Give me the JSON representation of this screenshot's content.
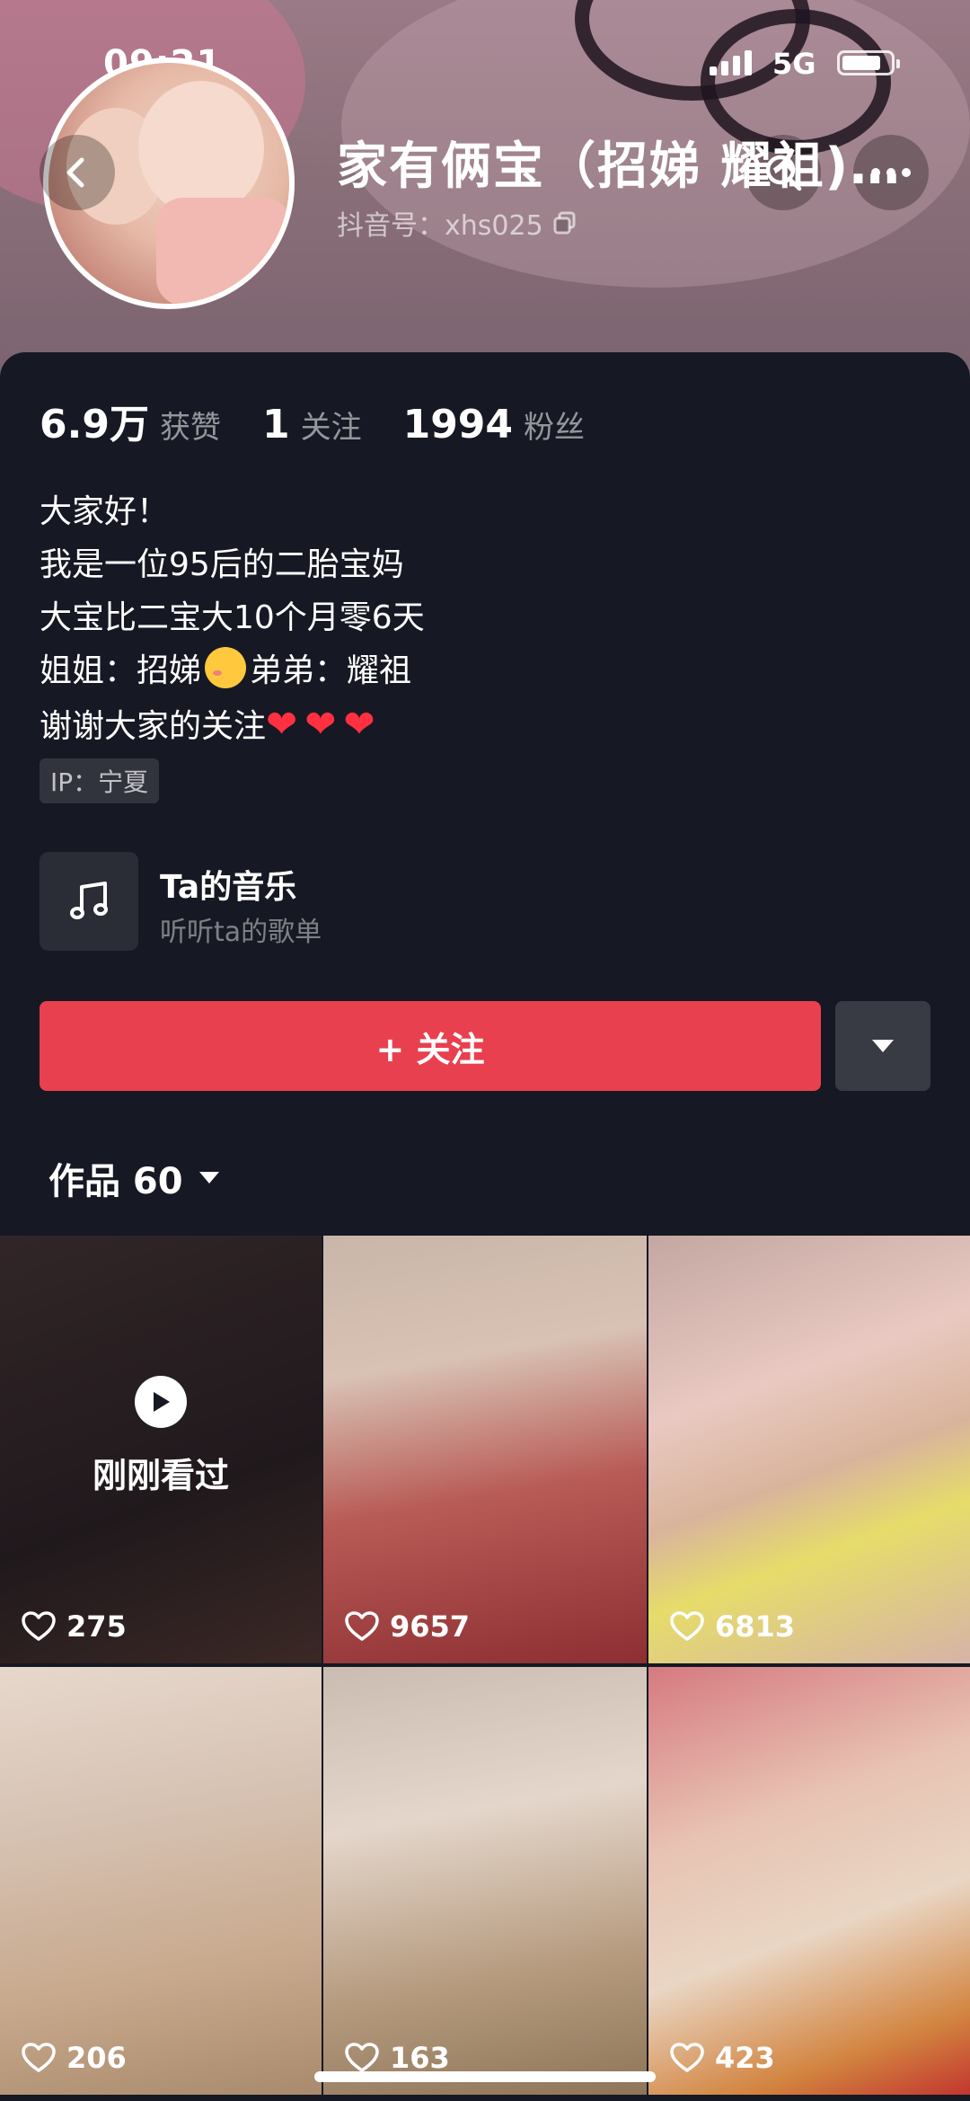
{
  "status_bar": {
    "time": "09:21",
    "network": "5G"
  },
  "profile": {
    "nickname": "家有俩宝（招娣 耀祖)…",
    "douyin_id": "抖音号：xhs025"
  },
  "stats": [
    {
      "value": "6.9万",
      "label": "获赞"
    },
    {
      "value": "1",
      "label": "关注"
    },
    {
      "value": "1994",
      "label": "粉丝"
    }
  ],
  "bio": {
    "line1": "大家好！",
    "line2": "我是一位95后的二胎宝妈",
    "line3": "大宝比二宝大10个月零6天",
    "line4_a": "姐姐：招娣",
    "line4_b": "弟弟：耀祖",
    "line5": "谢谢大家的关注",
    "ip": "IP：宁夏"
  },
  "music": {
    "title": "Ta的音乐",
    "subtitle": "听听ta的歌单"
  },
  "follow_button": "+ 关注",
  "works_tab": {
    "label": "作品 60"
  },
  "videos": [
    {
      "likes": "275",
      "overlay": "刚刚看过"
    },
    {
      "likes": "9657"
    },
    {
      "likes": "6813"
    },
    {
      "likes": "206"
    },
    {
      "likes": "163"
    },
    {
      "likes": "423"
    }
  ],
  "colors": {
    "accent": "#e8404f",
    "background": "#161823",
    "heart": "#ff3040"
  },
  "icons": [
    "back-icon",
    "search-icon",
    "more-icon",
    "copy-icon",
    "music-note-icon",
    "chevron-down-icon",
    "play-icon",
    "heart-icon"
  ]
}
